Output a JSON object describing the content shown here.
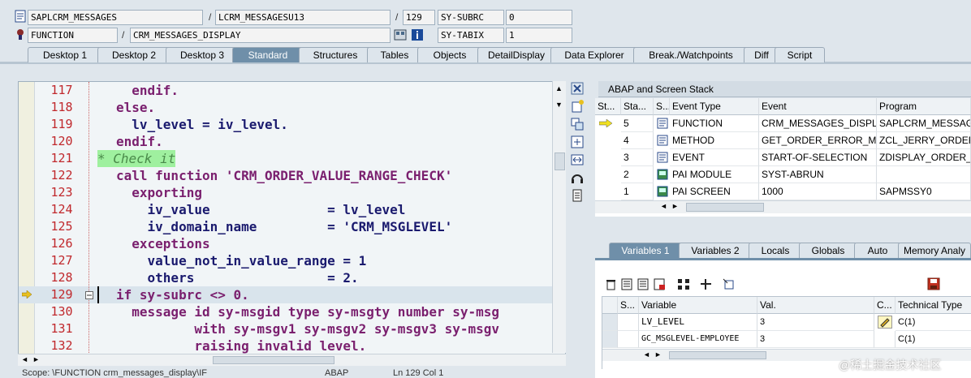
{
  "header": {
    "program": "SAPLCRM_MESSAGES",
    "include": "LCRM_MESSAGESU13",
    "line": "129",
    "var1_name": "SY-SUBRC",
    "var1_value": "0",
    "type": "FUNCTION",
    "name": "CRM_MESSAGES_DISPLAY",
    "var2_name": "SY-TABIX",
    "var2_value": "1"
  },
  "tabs": [
    "Desktop 1",
    "Desktop 2",
    "Desktop 3",
    "Standard",
    "Structures",
    "Tables",
    "Objects",
    "DetailDisplay",
    "Data Explorer",
    "Break./Watchpoints",
    "Diff",
    "Script"
  ],
  "active_tab": "Standard",
  "editor": {
    "lines": [
      {
        "num": "117",
        "code": "  endif."
      },
      {
        "num": "118",
        "code": "else."
      },
      {
        "num": "119",
        "code": "  lv_level = iv_level."
      },
      {
        "num": "120",
        "code": "endif."
      },
      {
        "num": "121",
        "code": "* Check it"
      },
      {
        "num": "122",
        "code": "call function 'CRM_ORDER_VALUE_RANGE_CHECK'"
      },
      {
        "num": "123",
        "code": "  exporting"
      },
      {
        "num": "124",
        "code": "    iv_value               = lv_level"
      },
      {
        "num": "125",
        "code": "    iv_domain_name         = 'CRM_MSGLEVEL'"
      },
      {
        "num": "126",
        "code": "  exceptions"
      },
      {
        "num": "127",
        "code": "    value_not_in_value_range = 1"
      },
      {
        "num": "128",
        "code": "    others                 = 2."
      },
      {
        "num": "129",
        "code": "if sy-subrc <> 0."
      },
      {
        "num": "130",
        "code": "  message id sy-msgid type sy-msgty number sy-msg"
      },
      {
        "num": "131",
        "code": "          with sy-msgv1 sy-msgv2 sy-msgv3 sy-msgv"
      },
      {
        "num": "132",
        "code": "          raising invalid level."
      }
    ]
  },
  "statusbar": {
    "scope": "Scope: \\FUNCTION crm_messages_display\\IF",
    "lang": "ABAP",
    "pos": "Ln 129 Col 1"
  },
  "stack": {
    "title": "ABAP and Screen Stack",
    "columns": [
      "St...",
      "Sta...",
      "S...",
      "Event Type",
      "Event",
      "Program"
    ],
    "rows": [
      {
        "level": "5",
        "type": "FUNCTION",
        "event": "CRM_MESSAGES_DISPLA...",
        "program": "SAPLCRM_MESSAGES",
        "current": true
      },
      {
        "level": "4",
        "type": "METHOD",
        "event": "GET_ORDER_ERROR_ME...",
        "program": "ZCL_JERRY_ORDER_...",
        "current": false
      },
      {
        "level": "3",
        "type": "EVENT",
        "event": "START-OF-SELECTION",
        "program": "ZDISPLAY_ORDER_L...",
        "current": false
      },
      {
        "level": "2",
        "type": "PAI MODULE",
        "event": "SYST-ABRUN",
        "program": "",
        "current": false
      },
      {
        "level": "1",
        "type": "PAI SCREEN",
        "event": "1000",
        "program": "SAPMSSY0",
        "current": false
      }
    ]
  },
  "var_tabs": [
    "Variables 1",
    "Variables 2",
    "Locals",
    "Globals",
    "Auto",
    "Memory Analy"
  ],
  "variables": {
    "columns": [
      "S...",
      "Variable",
      "Val.",
      "C...",
      "Technical Type"
    ],
    "rows": [
      {
        "name": "LV_LEVEL",
        "value": "3",
        "type": "C(1)"
      },
      {
        "name": "GC_MSGLEVEL-EMPLOYEE",
        "value": "3",
        "type": "C(1)"
      }
    ]
  },
  "watermark": "@稀土掘金技术社区",
  "colors": {
    "accent": "#6f8fa9",
    "linenum": "#c0282c",
    "comment_bg": "#9ff09f"
  }
}
